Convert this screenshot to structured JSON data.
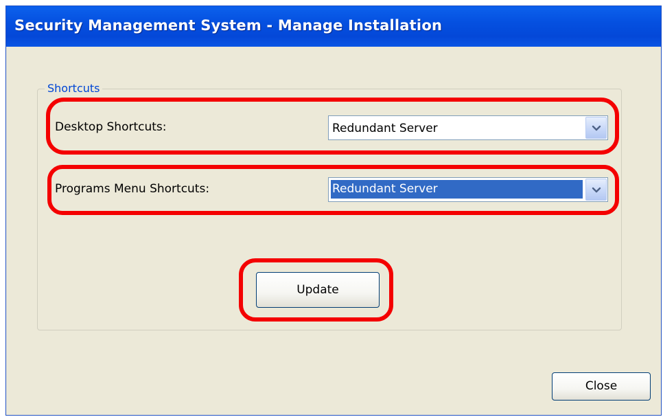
{
  "window": {
    "title": "Security Management System - Manage Installation"
  },
  "shortcuts": {
    "group_label": "Shortcuts",
    "desktop": {
      "label": "Desktop Shortcuts:",
      "value": "Redundant Server"
    },
    "programs_menu": {
      "label": "Programs Menu Shortcuts:",
      "value": "Redundant Server"
    },
    "update_label": "Update"
  },
  "footer": {
    "close_label": "Close"
  },
  "colors": {
    "titlebar": "#0550E0",
    "window_bg": "#ECE9D8",
    "selection": "#316AC5",
    "highlight_annotation": "#F40000",
    "group_label": "#0046D5"
  },
  "icons": {
    "dropdown": "chevron-down-icon"
  }
}
